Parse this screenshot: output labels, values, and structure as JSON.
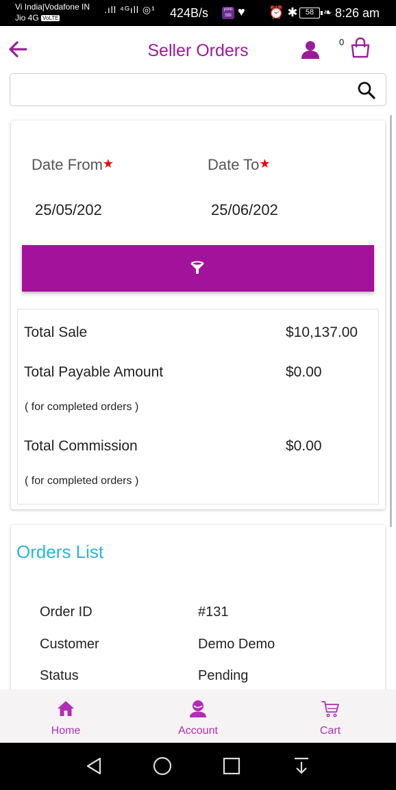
{
  "status_bar": {
    "carrier1": "Vi India|Vodafone IN",
    "carrier2": "Jio 4G",
    "volte": "VoLTE",
    "net_speed": "424B/s",
    "yono": "yono SBI",
    "battery": "58",
    "time": "8:26 am"
  },
  "header": {
    "title": "Seller Orders",
    "cart_count": "0",
    "accent_color": "#9b1c9a"
  },
  "search": {
    "value": "",
    "placeholder": ""
  },
  "filter": {
    "date_from_label": "Date From",
    "date_to_label": "Date To",
    "required_mark": "★",
    "date_from_value": "25/05/202",
    "date_to_value": "25/06/202",
    "button_icon": "filter-icon",
    "button_color": "#a3129a"
  },
  "summary": {
    "total_sale_label": "Total Sale",
    "total_sale_value": "$10,137.00",
    "total_payable_label": "Total Payable Amount",
    "total_payable_value": "$0.00",
    "payable_note": "( for completed orders )",
    "total_commission_label": "Total Commission",
    "total_commission_value": "$0.00",
    "commission_note": "( for completed orders )"
  },
  "orders": {
    "title": "Orders List",
    "title_color": "#27b6d6",
    "rows": [
      {
        "label": "Order ID",
        "value": "#131"
      },
      {
        "label": "Customer",
        "value": "Demo Demo"
      },
      {
        "label": "Status",
        "value": "Pending"
      }
    ]
  },
  "bottom_nav": {
    "items": [
      {
        "label": "Home",
        "icon": "home-icon"
      },
      {
        "label": "Account",
        "icon": "account-icon"
      },
      {
        "label": "Cart",
        "icon": "cart-icon"
      }
    ]
  }
}
